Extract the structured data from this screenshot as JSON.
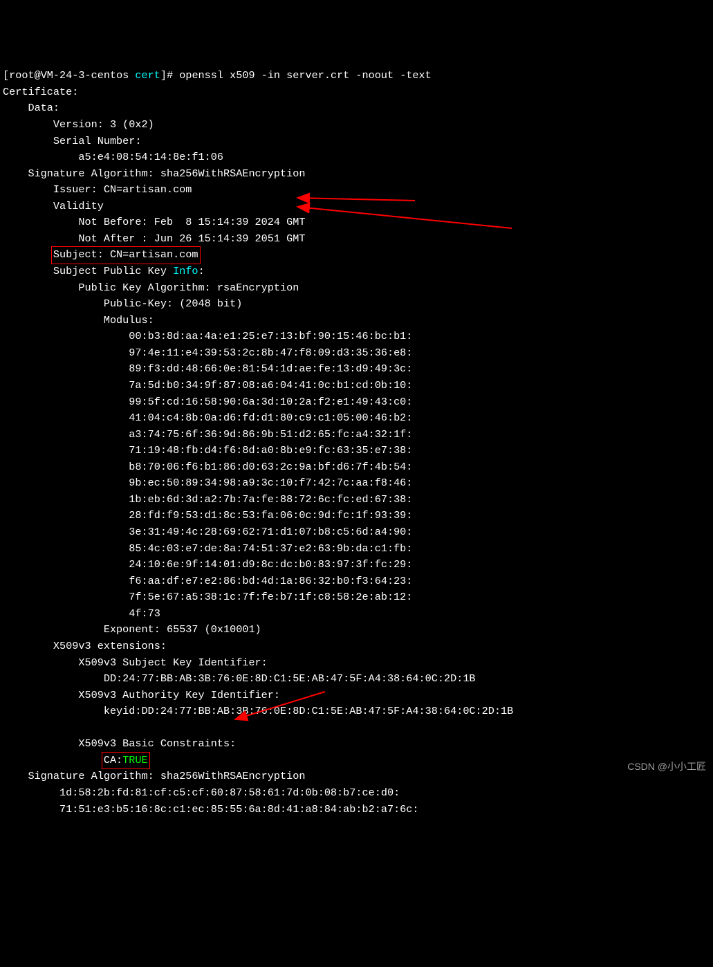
{
  "prompt": {
    "open_br": "[",
    "user": "root@VM-24-3-centos",
    "dir": " cert",
    "close_br": "]# ",
    "cmd": "openssl x509 -in server.crt -noout -text"
  },
  "l01": "Certificate:",
  "l02": "    Data:",
  "l03": "        Version: 3 (0x2)",
  "l04": "        Serial Number:",
  "l05": "            a5:e4:08:54:14:8e:f1:06",
  "l06": "    Signature Algorithm: sha256WithRSAEncryption",
  "l07": "        Issuer: CN=artisan.com",
  "l08": "        Validity",
  "l09": "            Not Before: Feb  8 15:14:39 2024 GMT",
  "l10": "            Not After : Jun 26 15:14:39 2051 GMT",
  "subj_pre": "        ",
  "subj_txt": "Subject: CN=artisan.com",
  "spki_pre": "        ",
  "spki_label": "Subject Public Key ",
  "spki_info": "Info",
  "spki_colon": ":",
  "l13": "            Public Key Algorithm: rsaEncryption",
  "l14": "                Public-Key: (2048 bit)",
  "l15": "                Modulus:",
  "mod": [
    "                    00:b3:8d:aa:4a:e1:25:e7:13:bf:90:15:46:bc:b1:",
    "                    97:4e:11:e4:39:53:2c:8b:47:f8:09:d3:35:36:e8:",
    "                    89:f3:dd:48:66:0e:81:54:1d:ae:fe:13:d9:49:3c:",
    "                    7a:5d:b0:34:9f:87:08:a6:04:41:0c:b1:cd:0b:10:",
    "                    99:5f:cd:16:58:90:6a:3d:10:2a:f2:e1:49:43:c0:",
    "                    41:04:c4:8b:0a:d6:fd:d1:80:c9:c1:05:00:46:b2:",
    "                    a3:74:75:6f:36:9d:86:9b:51:d2:65:fc:a4:32:1f:",
    "                    71:19:48:fb:d4:f6:8d:a0:8b:e9:fc:63:35:e7:38:",
    "                    b8:70:06:f6:b1:86:d0:63:2c:9a:bf:d6:7f:4b:54:",
    "                    9b:ec:50:89:34:98:a9:3c:10:f7:42:7c:aa:f8:46:",
    "                    1b:eb:6d:3d:a2:7b:7a:fe:88:72:6c:fc:ed:67:38:",
    "                    28:fd:f9:53:d1:8c:53:fa:06:0c:9d:fc:1f:93:39:",
    "                    3e:31:49:4c:28:69:62:71:d1:07:b8:c5:6d:a4:90:",
    "                    85:4c:03:e7:de:8a:74:51:37:e2:63:9b:da:c1:fb:",
    "                    24:10:6e:9f:14:01:d9:8c:dc:b0:83:97:3f:fc:29:",
    "                    f6:aa:df:e7:e2:86:bd:4d:1a:86:32:b0:f3:64:23:",
    "                    7f:5e:67:a5:38:1c:7f:fe:b7:1f:c8:58:2e:ab:12:",
    "                    4f:73"
  ],
  "l16": "                Exponent: 65537 (0x10001)",
  "l17": "        X509v3 extensions:",
  "l18": "            X509v3 Subject Key Identifier: ",
  "l19": "                DD:24:77:BB:AB:3B:76:0E:8D:C1:5E:AB:47:5F:A4:38:64:0C:2D:1B",
  "l20": "            X509v3 Authority Key Identifier: ",
  "l21": "                keyid:DD:24:77:BB:AB:3B:76:0E:8D:C1:5E:AB:47:5F:A4:38:64:0C:2D:1B",
  "blank": "",
  "l22": "            X509v3 Basic Constraints: ",
  "ca_pre": "                ",
  "ca_lab": "CA:",
  "ca_val": "TRUE",
  "l23": "    Signature Algorithm: sha256WithRSAEncryption",
  "l24": "         1d:58:2b:fd:81:cf:c5:cf:60:87:58:61:7d:0b:08:b7:ce:d0:",
  "l25": "         71:51:e3:b5:16:8c:c1:ec:85:55:6a:8d:41:a8:84:ab:b2:a7:6c:",
  "watermark": "CSDN @小小工匠"
}
